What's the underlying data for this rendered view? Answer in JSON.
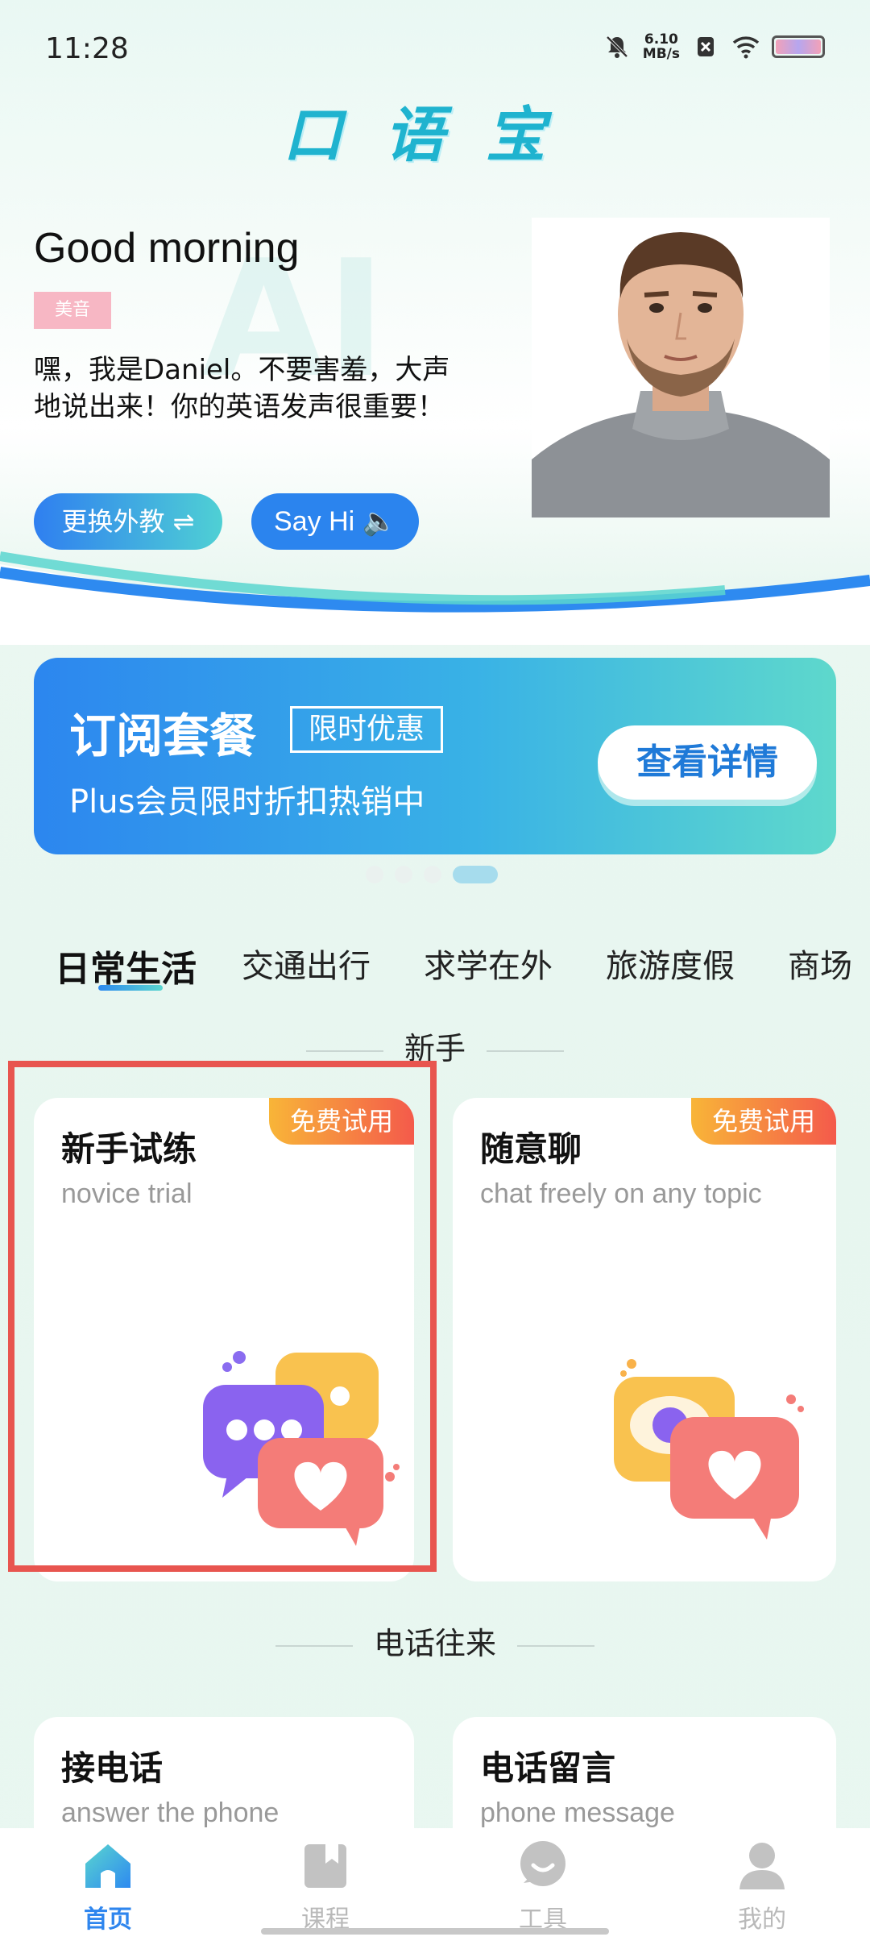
{
  "status_bar": {
    "time": "11:28",
    "net_speed_value": "6.10",
    "net_speed_unit": "MB/s"
  },
  "app": {
    "logo_text": "口语宝"
  },
  "hero": {
    "greeting": "Good morning",
    "accent_badge": "美音",
    "intro": "嘿，我是Daniel。不要害羞，大声地说出来！你的英语发声很重要！",
    "change_tutor_button": "更换外教 ⇌",
    "say_hi_button": "Say Hi 🔈"
  },
  "promo_banner": {
    "title": "订阅套餐",
    "tag": "限时优惠",
    "subtitle": "Plus会员限时折扣热销中",
    "button": "查看详情",
    "dots_count": 4,
    "active_dot": 3
  },
  "category_tabs": [
    "日常生活",
    "交通出行",
    "求学在外",
    "旅游度假",
    "商场"
  ],
  "active_tab": 0,
  "sections": [
    {
      "title": "新手",
      "cards": [
        {
          "title": "新手试练",
          "subtitle": "novice trial",
          "badge": "免费试用"
        },
        {
          "title": "随意聊",
          "subtitle": "chat freely on any topic",
          "badge": "免费试用"
        }
      ]
    },
    {
      "title": "电话往来",
      "cards": [
        {
          "title": "接电话",
          "subtitle": "answer the phone"
        },
        {
          "title": "电话留言",
          "subtitle": "phone message"
        }
      ]
    }
  ],
  "bottom_nav": [
    {
      "label": "首页",
      "icon": "home-icon"
    },
    {
      "label": "课程",
      "icon": "book-icon"
    },
    {
      "label": "工具",
      "icon": "chat-icon"
    },
    {
      "label": "我的",
      "icon": "profile-icon"
    }
  ],
  "colors": {
    "primary_blue": "#2b84ee",
    "teal": "#5ed8cc",
    "badge_orange": "#f8b538",
    "badge_red": "#f45a4b",
    "highlight_red": "#e8554f"
  }
}
